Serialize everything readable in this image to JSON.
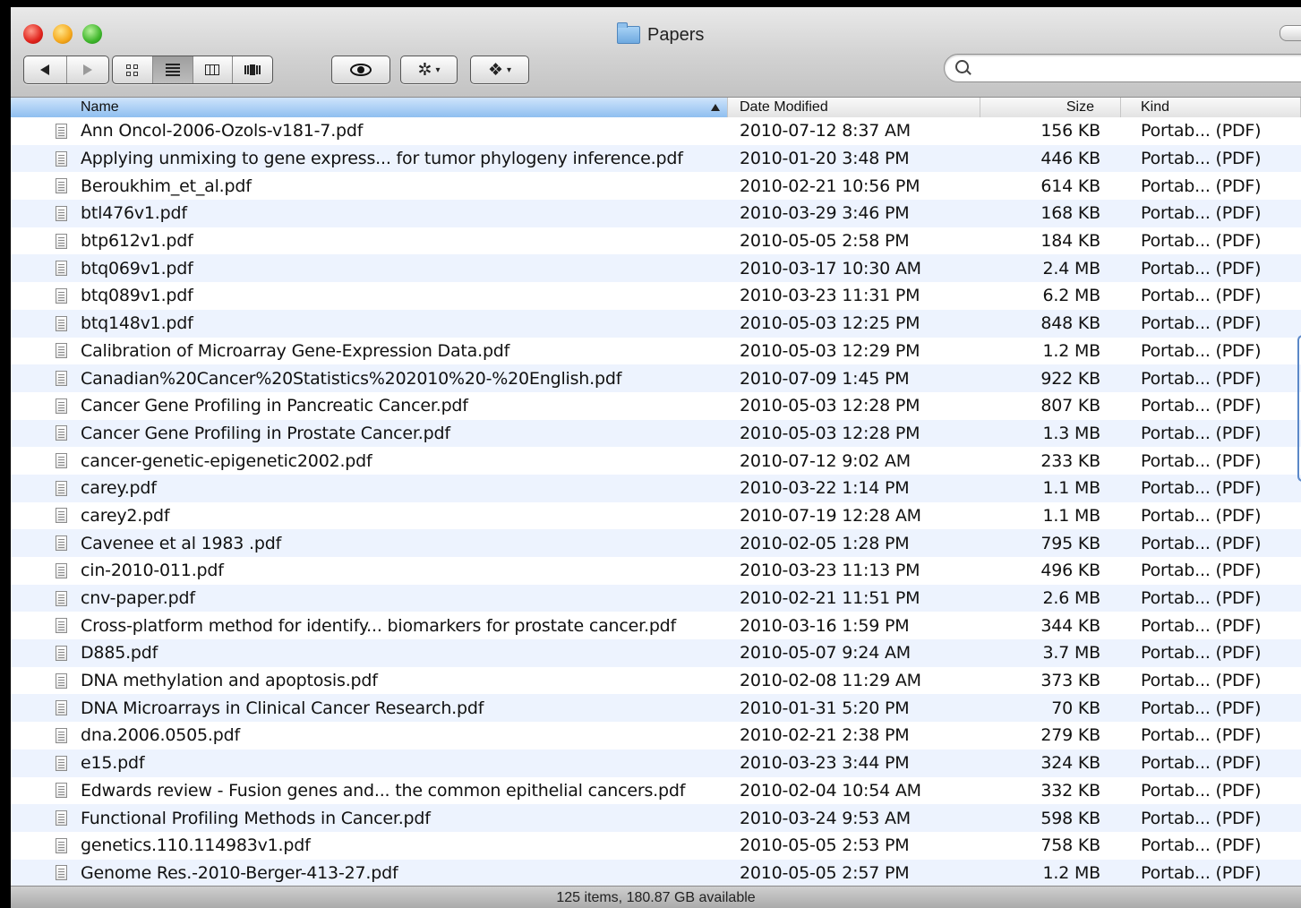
{
  "window": {
    "title": "Papers"
  },
  "toolbar": {
    "back": "back",
    "forward": "forward",
    "views": [
      "icon-view",
      "list-view",
      "column-view",
      "cover-flow-view"
    ],
    "search_placeholder": ""
  },
  "columns": {
    "name": "Name",
    "date": "Date Modified",
    "size": "Size",
    "kind": "Kind"
  },
  "files": [
    {
      "name": "Ann Oncol-2006-Ozols-v181-7.pdf",
      "date": "2010-07-12 8:37 AM",
      "size": "156 KB",
      "kind": "Portab... (PDF)"
    },
    {
      "name": "Applying unmixing to gene express... for tumor phylogeny inference.pdf",
      "date": "2010-01-20 3:48 PM",
      "size": "446 KB",
      "kind": "Portab... (PDF)"
    },
    {
      "name": "Beroukhim_et_al.pdf",
      "date": "2010-02-21 10:56 PM",
      "size": "614 KB",
      "kind": "Portab... (PDF)"
    },
    {
      "name": "btl476v1.pdf",
      "date": "2010-03-29 3:46 PM",
      "size": "168 KB",
      "kind": "Portab... (PDF)"
    },
    {
      "name": "btp612v1.pdf",
      "date": "2010-05-05 2:58 PM",
      "size": "184 KB",
      "kind": "Portab... (PDF)"
    },
    {
      "name": "btq069v1.pdf",
      "date": "2010-03-17 10:30 AM",
      "size": "2.4 MB",
      "kind": "Portab... (PDF)"
    },
    {
      "name": "btq089v1.pdf",
      "date": "2010-03-23 11:31 PM",
      "size": "6.2 MB",
      "kind": "Portab... (PDF)"
    },
    {
      "name": "btq148v1.pdf",
      "date": "2010-05-03 12:25 PM",
      "size": "848 KB",
      "kind": "Portab... (PDF)"
    },
    {
      "name": "Calibration of Microarray Gene-Expression Data.pdf",
      "date": "2010-05-03 12:29 PM",
      "size": "1.2 MB",
      "kind": "Portab... (PDF)"
    },
    {
      "name": "Canadian%20Cancer%20Statistics%202010%20-%20English.pdf",
      "date": "2010-07-09 1:45 PM",
      "size": "922 KB",
      "kind": "Portab... (PDF)"
    },
    {
      "name": "Cancer Gene Profiling in Pancreatic Cancer.pdf",
      "date": "2010-05-03 12:28 PM",
      "size": "807 KB",
      "kind": "Portab... (PDF)"
    },
    {
      "name": "Cancer Gene Profiling in Prostate Cancer.pdf",
      "date": "2010-05-03 12:28 PM",
      "size": "1.3 MB",
      "kind": "Portab... (PDF)"
    },
    {
      "name": "cancer-genetic-epigenetic2002.pdf",
      "date": "2010-07-12 9:02 AM",
      "size": "233 KB",
      "kind": "Portab... (PDF)"
    },
    {
      "name": "carey.pdf",
      "date": "2010-03-22 1:14 PM",
      "size": "1.1 MB",
      "kind": "Portab... (PDF)"
    },
    {
      "name": "carey2.pdf",
      "date": "2010-07-19 12:28 AM",
      "size": "1.1 MB",
      "kind": "Portab... (PDF)"
    },
    {
      "name": "Cavenee et al 1983 .pdf",
      "date": "2010-02-05 1:28 PM",
      "size": "795 KB",
      "kind": "Portab... (PDF)"
    },
    {
      "name": "cin-2010-011.pdf",
      "date": "2010-03-23 11:13 PM",
      "size": "496 KB",
      "kind": "Portab... (PDF)"
    },
    {
      "name": "cnv-paper.pdf",
      "date": "2010-02-21 11:51 PM",
      "size": "2.6 MB",
      "kind": "Portab... (PDF)"
    },
    {
      "name": "Cross-platform method for identify... biomarkers for prostate cancer.pdf",
      "date": "2010-03-16 1:59 PM",
      "size": "344 KB",
      "kind": "Portab... (PDF)"
    },
    {
      "name": "D885.pdf",
      "date": "2010-05-07 9:24 AM",
      "size": "3.7 MB",
      "kind": "Portab... (PDF)"
    },
    {
      "name": "DNA methylation and apoptosis.pdf",
      "date": "2010-02-08 11:29 AM",
      "size": "373 KB",
      "kind": "Portab... (PDF)"
    },
    {
      "name": "DNA Microarrays in Clinical Cancer Research.pdf",
      "date": "2010-01-31 5:20 PM",
      "size": "70 KB",
      "kind": "Portab... (PDF)"
    },
    {
      "name": "dna.2006.0505.pdf",
      "date": "2010-02-21 2:38 PM",
      "size": "279 KB",
      "kind": "Portab... (PDF)"
    },
    {
      "name": "e15.pdf",
      "date": "2010-03-23 3:44 PM",
      "size": "324 KB",
      "kind": "Portab... (PDF)"
    },
    {
      "name": "Edwards review - Fusion genes and... the common epithelial cancers.pdf",
      "date": "2010-02-04 10:54 AM",
      "size": "332 KB",
      "kind": "Portab... (PDF)"
    },
    {
      "name": "Functional Profiling Methods in Cancer.pdf",
      "date": "2010-03-24 9:53 AM",
      "size": "598 KB",
      "kind": "Portab... (PDF)"
    },
    {
      "name": "genetics.110.114983v1.pdf",
      "date": "2010-05-05 2:53 PM",
      "size": "758 KB",
      "kind": "Portab... (PDF)"
    },
    {
      "name": "Genome Res.-2010-Berger-413-27.pdf",
      "date": "2010-05-05 2:57 PM",
      "size": "1.2 MB",
      "kind": "Portab... (PDF)"
    }
  ],
  "status": {
    "text": "125 items, 180.87 GB available"
  }
}
